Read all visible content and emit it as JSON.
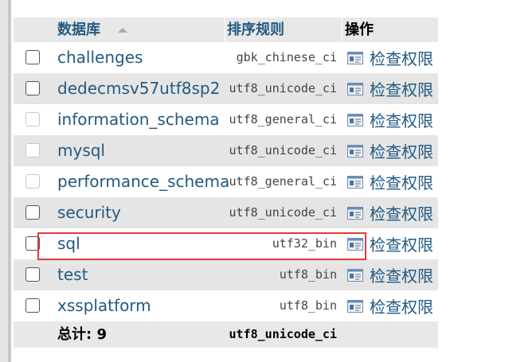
{
  "header": {
    "db_label": "数据库",
    "collation_label": "排序规则",
    "action_label": "操作"
  },
  "rows": [
    {
      "name": "challenges",
      "collation": "gbk_chinese_ci",
      "action": "检查权限"
    },
    {
      "name": "dedecmsv57utf8sp2",
      "collation": "utf8_unicode_ci",
      "action": "检查权限"
    },
    {
      "name": "information_schema",
      "collation": "utf8_general_ci",
      "action": "检查权限"
    },
    {
      "name": "mysql",
      "collation": "utf8_unicode_ci",
      "action": "检查权限"
    },
    {
      "name": "performance_schema",
      "collation": "utf8_general_ci",
      "action": "检查权限"
    },
    {
      "name": "security",
      "collation": "utf8_unicode_ci",
      "action": "检查权限"
    },
    {
      "name": "sql",
      "collation": "utf32_bin",
      "action": "检查权限"
    },
    {
      "name": "test",
      "collation": "utf8_bin",
      "action": "检查权限"
    },
    {
      "name": "xssplatform",
      "collation": "utf8_bin",
      "action": "检查权限"
    }
  ],
  "footer": {
    "total_label": "总计: 9",
    "collation": "utf8_unicode_ci"
  },
  "icons": {
    "action_icon": "privileges-icon",
    "sort_icon": "sort-asc-icon"
  },
  "colors": {
    "link": "#235a81",
    "highlight_border": "#e03a3a",
    "row_alt": "#e5e5e5"
  }
}
